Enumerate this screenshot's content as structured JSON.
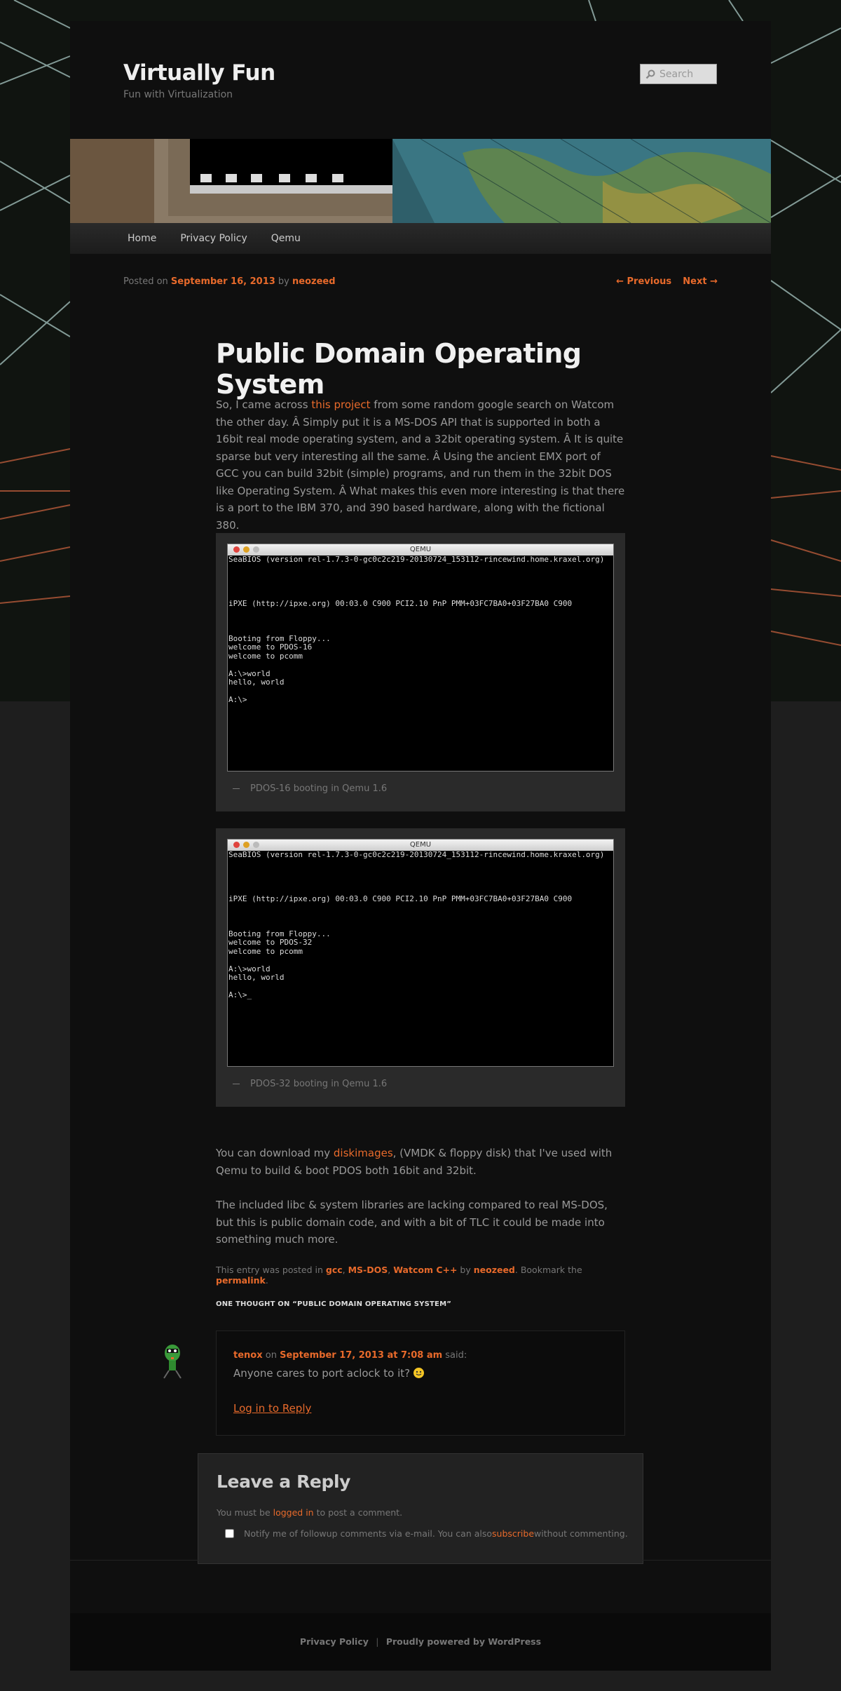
{
  "site": {
    "title": "Virtually Fun",
    "description": "Fun with Virtualization",
    "search_placeholder": "Search"
  },
  "nav": {
    "items": [
      {
        "label": "Home"
      },
      {
        "label": "Privacy Policy"
      },
      {
        "label": "Qemu"
      }
    ]
  },
  "post_nav": {
    "posted_on": "Posted on",
    "date": "September 16, 2013",
    "by": "by",
    "author": "neozeed",
    "previous": "← Previous",
    "next": "Next →"
  },
  "article": {
    "title": "Public Domain Operating System",
    "p1_before": "So, I came across ",
    "p1_link": "this project",
    "p1_after": " from some random google search on Watcom the other day. Â Simply put it is a MS-DOS API that is supported in both a 16bit real mode operating system, and a 32bit operating system. Â It is quite sparse but very interesting all the same. Â Using the ancient EMX port of GCC you can build 32bit (simple) programs, and run them in the 32bit DOS like Operating System. Â What makes this even more interesting is that there is a port to the IBM 370, and 390 based hardware, along with the fictional 380.",
    "figure1": {
      "window_title": "QEMU",
      "terminal": "SeaBIOS (version rel-1.7.3-0-gc0c2c219-20130724_153112-rincewind.home.kraxel.org)\n\n\n\n\niPXE (http://ipxe.org) 00:03.0 C900 PCI2.10 PnP PMM+03FC7BA0+03F27BA0 C900\n\n\n\nBooting from Floppy...\nwelcome to PDOS-16\nwelcome to pcomm\n\nA:\\>world\nhello, world\n\nA:\\>",
      "caption": "PDOS-16 booting in Qemu 1.6"
    },
    "figure2": {
      "window_title": "QEMU",
      "terminal": "SeaBIOS (version rel-1.7.3-0-gc0c2c219-20130724_153112-rincewind.home.kraxel.org)\n\n\n\n\niPXE (http://ipxe.org) 00:03.0 C900 PCI2.10 PnP PMM+03FC7BA0+03F27BA0 C900\n\n\n\nBooting from Floppy...\nwelcome to PDOS-32\nwelcome to pcomm\n\nA:\\>world\nhello, world\n\nA:\\>_",
      "caption": "PDOS-32 booting in Qemu 1.6"
    },
    "p2_before": "You can download my ",
    "p2_link": "diskimages",
    "p2_after": ", (VMDK & floppy disk) that I've used with Qemu to build & boot PDOS both 16bit and 32bit.",
    "p3": "The included libc & system libraries are lacking compared to real MS-DOS, but this is public domain code, and with a bit of TLC it could be made into something much more.",
    "meta": {
      "prefix": "This entry was posted in ",
      "cat1": "gcc",
      "cat2": "MS-DOS",
      "cat3": "Watcom C++",
      "by": " by ",
      "author": "neozeed",
      "bookmark": ". Bookmark the ",
      "permalink": "permalink",
      "end": "."
    }
  },
  "comments": {
    "title": "One thought on “Public Domain Operating System”",
    "items": [
      {
        "author": "tenox",
        "on": " on ",
        "date": "September 17, 2013 at 7:08 am",
        "said": " said:",
        "text": "Anyone cares to port aclock to it? ",
        "reply": "Log in to Reply"
      }
    ]
  },
  "respond": {
    "title": "Leave a Reply",
    "must_be": "You must be ",
    "logged_in": "logged in",
    "to_post": " to post a comment.",
    "notify_before": "Notify me of followup comments via e-mail. You can also ",
    "subscribe": "subscribe",
    "notify_after": " without commenting."
  },
  "footer": {
    "privacy": "Privacy Policy",
    "separator": "|",
    "powered": "Proudly powered by WordPress"
  },
  "colors": {
    "accent": "#e86a2b",
    "page_bg": "#0f0f0f",
    "body_bg": "#1e1e1e"
  }
}
